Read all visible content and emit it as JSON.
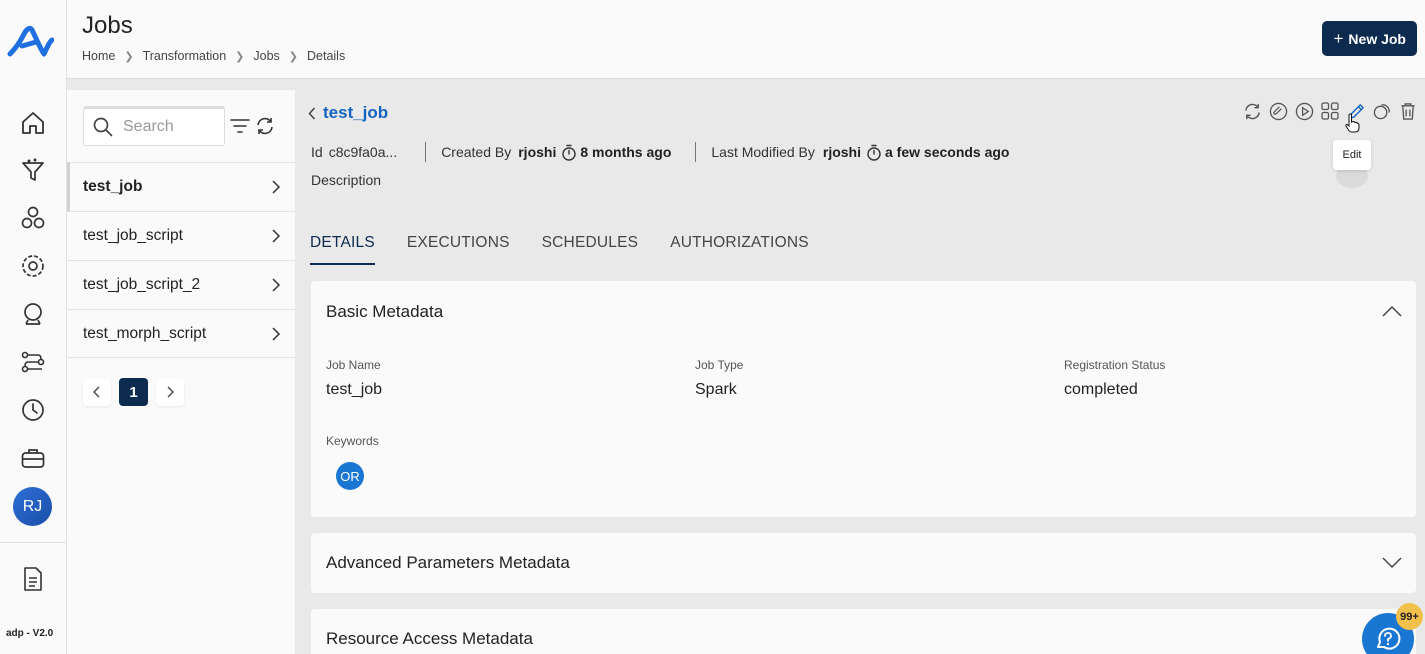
{
  "header": {
    "title": "Jobs",
    "breadcrumbs": [
      "Home",
      "Transformation",
      "Jobs",
      "Details"
    ],
    "new_job_label": "New Job"
  },
  "rail": {
    "avatar_initials": "RJ",
    "version": "adp - V2.0",
    "icons": [
      "home-icon",
      "funnel-icon",
      "dataset-icon",
      "settings-gear-icon",
      "crystal-ball-icon",
      "pipeline-icon",
      "clock-icon",
      "briefcase-icon",
      "document-icon"
    ]
  },
  "list": {
    "search_placeholder": "Search",
    "jobs": [
      {
        "name": "test_job",
        "active": true
      },
      {
        "name": "test_job_script",
        "active": false
      },
      {
        "name": "test_job_script_2",
        "active": false
      },
      {
        "name": "test_morph_script",
        "active": false
      }
    ],
    "current_page": "1"
  },
  "detail": {
    "job_name": "test_job",
    "id_label": "Id",
    "id_value": "c8c9fa0a...",
    "created_by_label": "Created By",
    "created_by": "rjoshi",
    "created_ago": "8 months ago",
    "modified_label": "Last Modified By",
    "modified_by": "rjoshi",
    "modified_ago": "a few seconds ago",
    "description_label": "Description",
    "tooltip": "Edit",
    "tabs": [
      "DETAILS",
      "EXECUTIONS",
      "SCHEDULES",
      "AUTHORIZATIONS"
    ],
    "basic": {
      "title": "Basic Metadata",
      "job_name_label": "Job Name",
      "job_name_value": "test_job",
      "job_type_label": "Job Type",
      "job_type_value": "Spark",
      "reg_label": "Registration Status",
      "reg_value": "completed",
      "keywords_label": "Keywords",
      "keyword_chip": "OR"
    },
    "advanced_title": "Advanced Parameters Metadata",
    "resource_title": "Resource Access Metadata"
  },
  "help": {
    "badge": "99+"
  },
  "colors": {
    "brand": "#1565c0",
    "navy": "#0d2a4f",
    "help_blue": "#1976d2",
    "badge": "#f2c14b"
  }
}
